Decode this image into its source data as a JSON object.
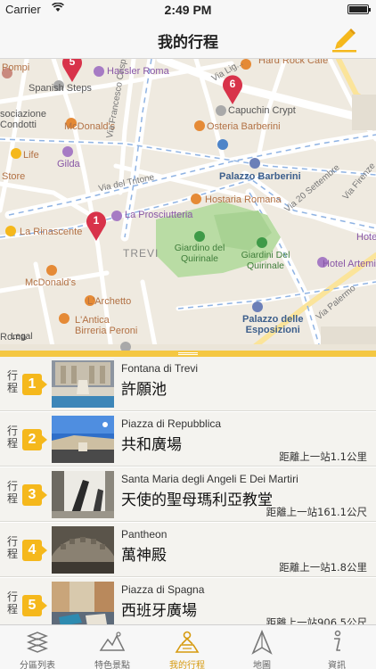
{
  "status_bar": {
    "carrier": "Carrier",
    "time": "2:49 PM"
  },
  "nav": {
    "title": "我的行程"
  },
  "map": {
    "labels": {
      "pompi": "Pompi",
      "spanish_steps": "Spanish Steps",
      "hassler": "Hassler Roma",
      "hard_rock": "Hard Rock Cafe",
      "via_lig": "Via Lig...",
      "sociazione": "sociazione",
      "condotti": "Condotti",
      "mcdonalds_1": "McDonald's",
      "via_crispi": "Via Francesco Crispi",
      "capuchin": "Capuchin Crypt",
      "osteria": "Osteria Barberini",
      "life": "Life",
      "gilda": "Gilda",
      "palazzo_barberini": "Palazzo Barberini",
      "store": "Store",
      "via_tritone": "Via del Tritone",
      "hostaria": "Hostaria Romana",
      "via_20_settembre": "Via 20 Settembre",
      "via_firenze": "Via Firenze",
      "prosciutteria": "La Prosciutteria",
      "rinascente": "La Rinascente",
      "trevi": "TREVI",
      "giardino_1": "Giardino del\nQuirinale",
      "giardino_2": "Giardini Del\nQuirinale",
      "hotel_artemide": "Hotel Artemi",
      "hote": "Hote",
      "mcdonalds_2": "McDonald's",
      "archetto": "L'Archetto",
      "antica": "L'Antica\nBirreria Peroni",
      "via_palermo": "Via Palermo",
      "palazzo_esposizioni": "Palazzo delle\nEsposizioni",
      "roma": "Roma",
      "legal": "Legal"
    },
    "pins": [
      {
        "label": "5",
        "color": "#d8334a"
      },
      {
        "label": "6",
        "color": "#d8334a"
      },
      {
        "label": "1",
        "color": "#d8334a"
      }
    ]
  },
  "itinerary": {
    "tag": "行程",
    "items": [
      {
        "num": "1",
        "en": "Fontana di Trevi",
        "zh": "許願池",
        "dist": ""
      },
      {
        "num": "2",
        "en": "Piazza di Repubblica",
        "zh": "共和廣場",
        "dist": "距離上一站1.1公里"
      },
      {
        "num": "3",
        "en": "Santa Maria degli Angeli E Dei Martiri",
        "zh": "天使的聖母瑪利亞教堂",
        "dist": "距離上一站161.1公尺"
      },
      {
        "num": "4",
        "en": "Pantheon",
        "zh": "萬神殿",
        "dist": "距離上一站1.8公里"
      },
      {
        "num": "5",
        "en": "Piazza di Spagna",
        "zh": "西班牙廣場",
        "dist": "距離上一站906.5公尺"
      }
    ]
  },
  "tabs": [
    {
      "label": "分區列表",
      "icon": "region-list-icon"
    },
    {
      "label": "特色景點",
      "icon": "attractions-icon"
    },
    {
      "label": "我的行程",
      "icon": "my-itinerary-icon",
      "active": true
    },
    {
      "label": "地圖",
      "icon": "map-icon"
    },
    {
      "label": "資訊",
      "icon": "info-icon"
    }
  ],
  "colors": {
    "accent": "#f5b81c",
    "active_tab": "#d69a0f",
    "pin": "#d8334a",
    "map_bg": "#efeae0",
    "park": "#b9dca4"
  }
}
